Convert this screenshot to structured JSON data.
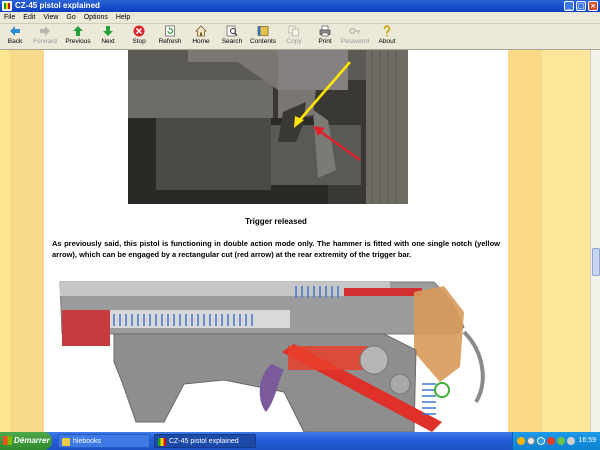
{
  "window": {
    "title": "CZ-45 pistol explained"
  },
  "menu": [
    "File",
    "Edit",
    "View",
    "Go",
    "Options",
    "Help"
  ],
  "toolbar": {
    "back": "Back",
    "forward": "Forward",
    "previous": "Previous",
    "next": "Next",
    "stop": "Stop",
    "refresh": "Refresh",
    "home": "Home",
    "search": "Search",
    "contents": "Contents",
    "copy": "Copy",
    "print": "Print",
    "password": "Password",
    "about": "About"
  },
  "page": {
    "caption": "Trigger released",
    "paragraph": "As previously said, this pistol is functioning in double action mode only. The hammer is fitted with one single notch (yellow arrow), which can be engaged by a rectangular cut (red arrow) at the rear extremity of the trigger bar."
  },
  "taskbar": {
    "start": "Démarrer",
    "tasks": [
      "hlebooks",
      "CZ-45 pistol explained"
    ],
    "clock": "16:59"
  },
  "colors": {
    "titlebar": "#0a3ec0",
    "taskbar": "#245edb",
    "page_stripe": "#fbe58f",
    "yellow_arrow": "#ffe600",
    "red_arrow": "#e0202a"
  }
}
